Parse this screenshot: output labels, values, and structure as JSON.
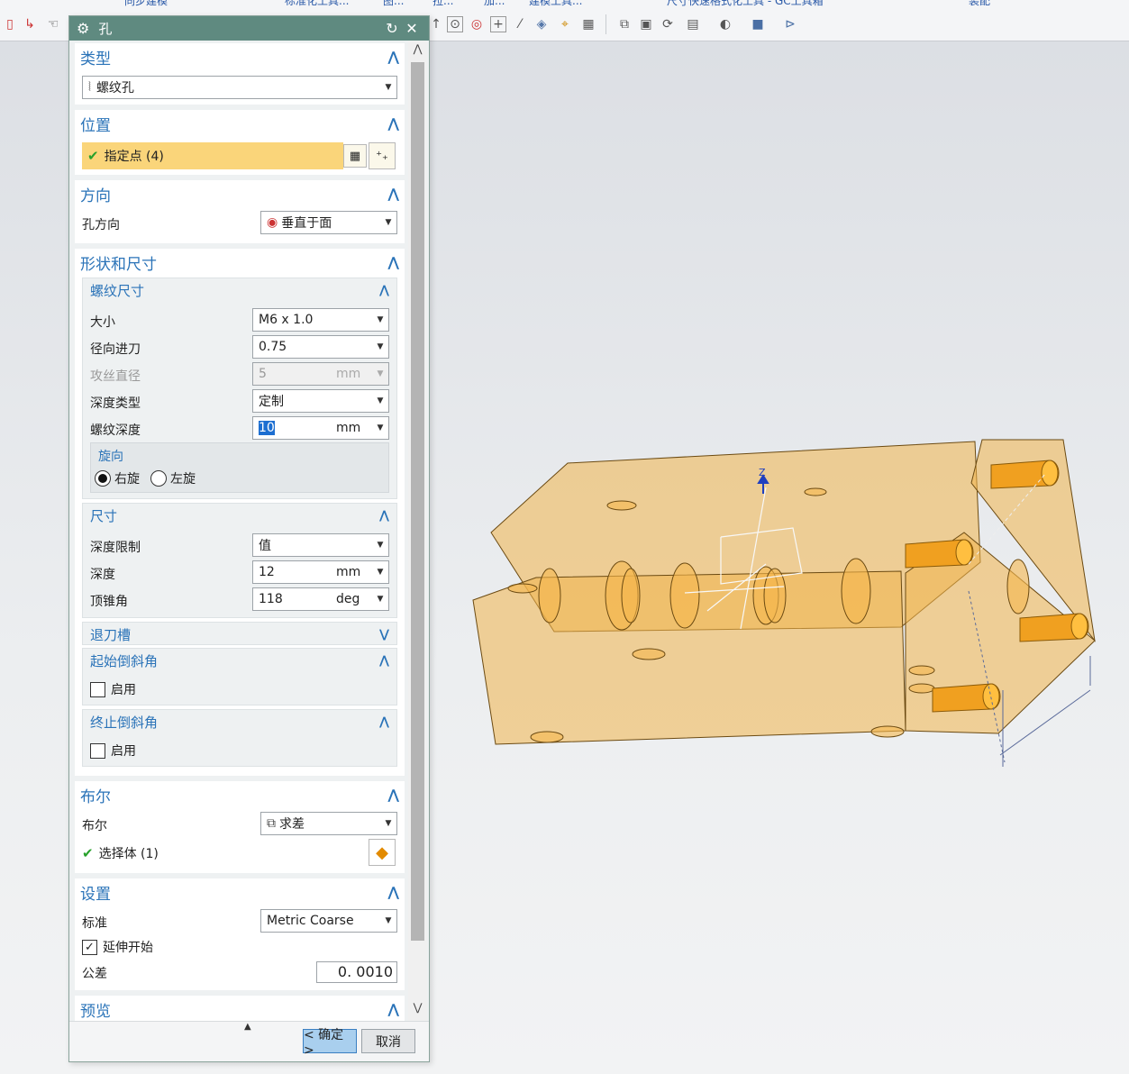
{
  "toolbar": {
    "tabs": [
      "同步建模",
      "标准化工具...",
      "拉...",
      "图...",
      "加...",
      "建模工具...",
      "尺寸快速格式化工具 - GC工具箱",
      "装配"
    ]
  },
  "dialog": {
    "title": "孔",
    "type": {
      "title": "类型",
      "value": "螺纹孔"
    },
    "position": {
      "title": "位置",
      "point_label": "指定点 (4)"
    },
    "direction": {
      "title": "方向",
      "label": "孔方向",
      "value": "垂直于面"
    },
    "shape": {
      "title": "形状和尺寸",
      "thread": {
        "title": "螺纹尺寸",
        "size_label": "大小",
        "size_value": "M6 x 1.0",
        "radial_label": "径向进刀",
        "radial_value": "0.75",
        "tap_label": "攻丝直径",
        "tap_value": "5",
        "tap_unit": "mm",
        "depth_type_label": "深度类型",
        "depth_type_value": "定制",
        "thread_depth_label": "螺纹深度",
        "thread_depth_value": "10",
        "thread_depth_unit": "mm",
        "rotation": {
          "title": "旋向",
          "right": "右旋",
          "left": "左旋",
          "selected": "right"
        }
      },
      "dimension": {
        "title": "尺寸",
        "limit_label": "深度限制",
        "limit_value": "值",
        "depth_label": "深度",
        "depth_value": "12",
        "depth_unit": "mm",
        "tip_label": "顶锥角",
        "tip_value": "118",
        "tip_unit": "deg"
      },
      "relief": {
        "title": "退刀槽"
      },
      "start_chamfer": {
        "title": "起始倒斜角",
        "enable": "启用",
        "checked": false
      },
      "end_chamfer": {
        "title": "终止倒斜角",
        "enable": "启用",
        "checked": false
      }
    },
    "boolean": {
      "title": "布尔",
      "label": "布尔",
      "value": "求差",
      "select_label": "选择体 (1)"
    },
    "settings": {
      "title": "设置",
      "standard_label": "标准",
      "standard_value": "Metric Coarse",
      "extend_label": "延伸开始",
      "extend_checked": true,
      "tolerance_label": "公差",
      "tolerance_value": "0. 0010"
    },
    "preview": {
      "title": "预览"
    },
    "ok": "< 确定 >",
    "cancel": "取消"
  },
  "viewport": {
    "axis_label": "Z"
  },
  "colors": {
    "accent": "#2a73b8",
    "titlebar": "#5f8a80",
    "highlight": "#fad57a",
    "model": "#f0b44c"
  }
}
